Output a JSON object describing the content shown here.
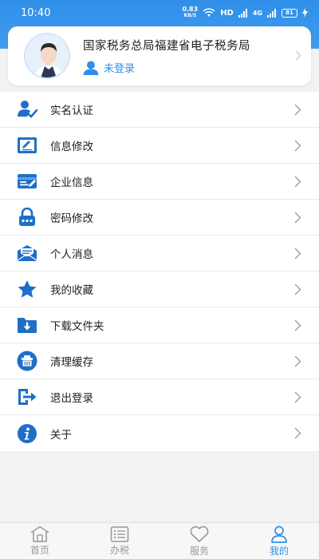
{
  "status_bar": {
    "time": "10:40",
    "net_speed": "0.83",
    "net_unit": "KB/S",
    "hd": "HD",
    "signal": "4G",
    "battery": "81"
  },
  "profile": {
    "org_name": "国家税务总局福建省电子税务局",
    "login_status": "未登录"
  },
  "menu": {
    "items": [
      {
        "label": "实名认证",
        "icon": "verify-user-icon"
      },
      {
        "label": "信息修改",
        "icon": "edit-icon"
      },
      {
        "label": "企业信息",
        "icon": "company-card-icon"
      },
      {
        "label": "密码修改",
        "icon": "lock-icon"
      },
      {
        "label": "个人消息",
        "icon": "message-icon"
      },
      {
        "label": "我的收藏",
        "icon": "star-icon"
      },
      {
        "label": "下载文件夹",
        "icon": "download-folder-icon"
      },
      {
        "label": "清理缓存",
        "icon": "trash-icon"
      },
      {
        "label": "退出登录",
        "icon": "logout-icon"
      },
      {
        "label": "关于",
        "icon": "info-icon"
      }
    ]
  },
  "tabs": [
    {
      "label": "首页",
      "icon": "home-icon",
      "active": false
    },
    {
      "label": "办税",
      "icon": "list-icon",
      "active": false
    },
    {
      "label": "服务",
      "icon": "heart-icon",
      "active": false
    },
    {
      "label": "我的",
      "icon": "user-icon",
      "active": true
    }
  ],
  "colors": {
    "accent": "#2f8fe8",
    "text": "#222222",
    "inactive_tab": "#999999"
  }
}
